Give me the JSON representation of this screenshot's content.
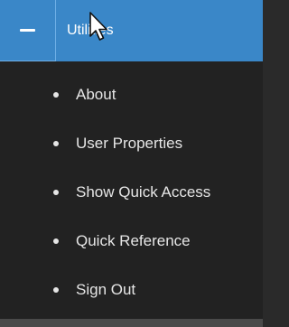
{
  "header": {
    "toggle_icon": "minus-icon",
    "title": "Utilities"
  },
  "menu": {
    "items": [
      {
        "label": "About"
      },
      {
        "label": "User Properties"
      },
      {
        "label": "Show Quick Access"
      },
      {
        "label": "Quick Reference"
      },
      {
        "label": "Sign Out"
      }
    ]
  },
  "colors": {
    "header_bg": "#3a87c8",
    "menu_bg": "#222222",
    "text": "#e6e6e6"
  }
}
